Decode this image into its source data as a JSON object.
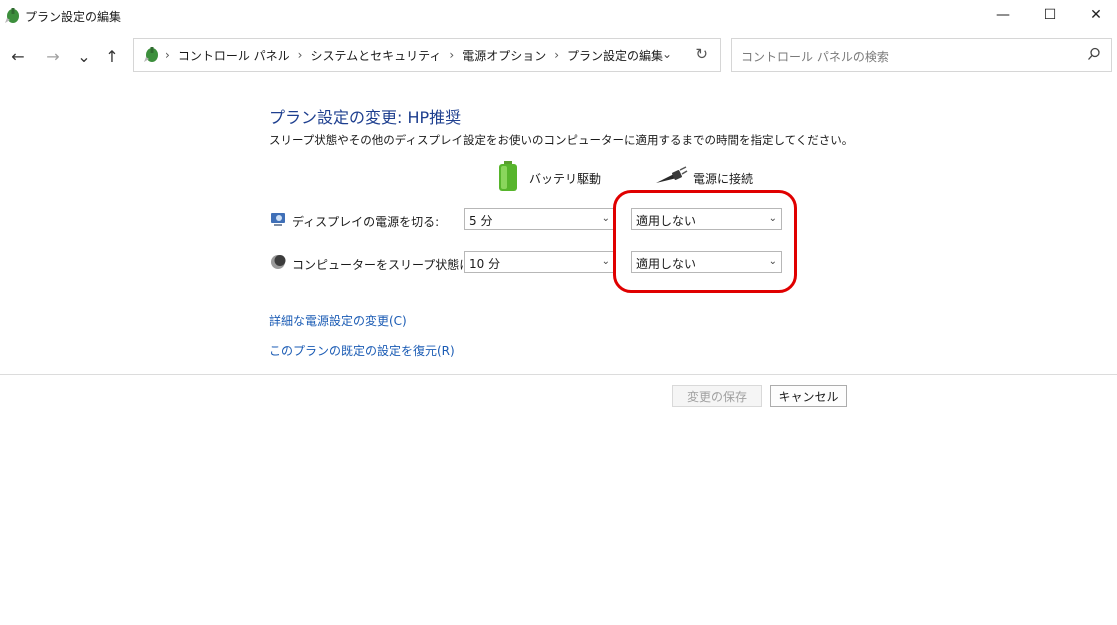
{
  "window": {
    "title": "プラン設定の編集",
    "icon": "power-options-icon",
    "minimize": "—",
    "maximize": "☐",
    "close": "✕"
  },
  "nav": {
    "back": "←",
    "forward": "→",
    "recent": "⌄",
    "up": "↑",
    "breadcrumbs": [
      "コントロール パネル",
      "システムとセキュリティ",
      "電源オプション",
      "プラン設定の編集"
    ],
    "separator": "›",
    "dropdown": "⌄",
    "refresh": "↻",
    "search_placeholder": "コントロール パネルの検索"
  },
  "main": {
    "heading": "プラン設定の変更: HP推奨",
    "description": "スリープ状態やその他のディスプレイ設定をお使いのコンピューターに適用するまでの時間を指定してください。",
    "columns": {
      "battery": "バッテリ駆動",
      "plugged": "電源に接続"
    },
    "rows": [
      {
        "label": "ディスプレイの電源を切る:",
        "battery_value": "5 分",
        "plugged_value": "適用しない"
      },
      {
        "label": "コンピューターをスリープ状態にする:",
        "battery_value": "10 分",
        "plugged_value": "適用しない"
      }
    ],
    "links": {
      "advanced": "詳細な電源設定の変更(C)",
      "restore": "このプランの既定の設定を復元(R)"
    }
  },
  "buttons": {
    "save": "変更の保存",
    "cancel": "キャンセル"
  },
  "colors": {
    "heading": "#1e3f8f",
    "link": "#1a5bb4",
    "highlight": "#e00000"
  }
}
